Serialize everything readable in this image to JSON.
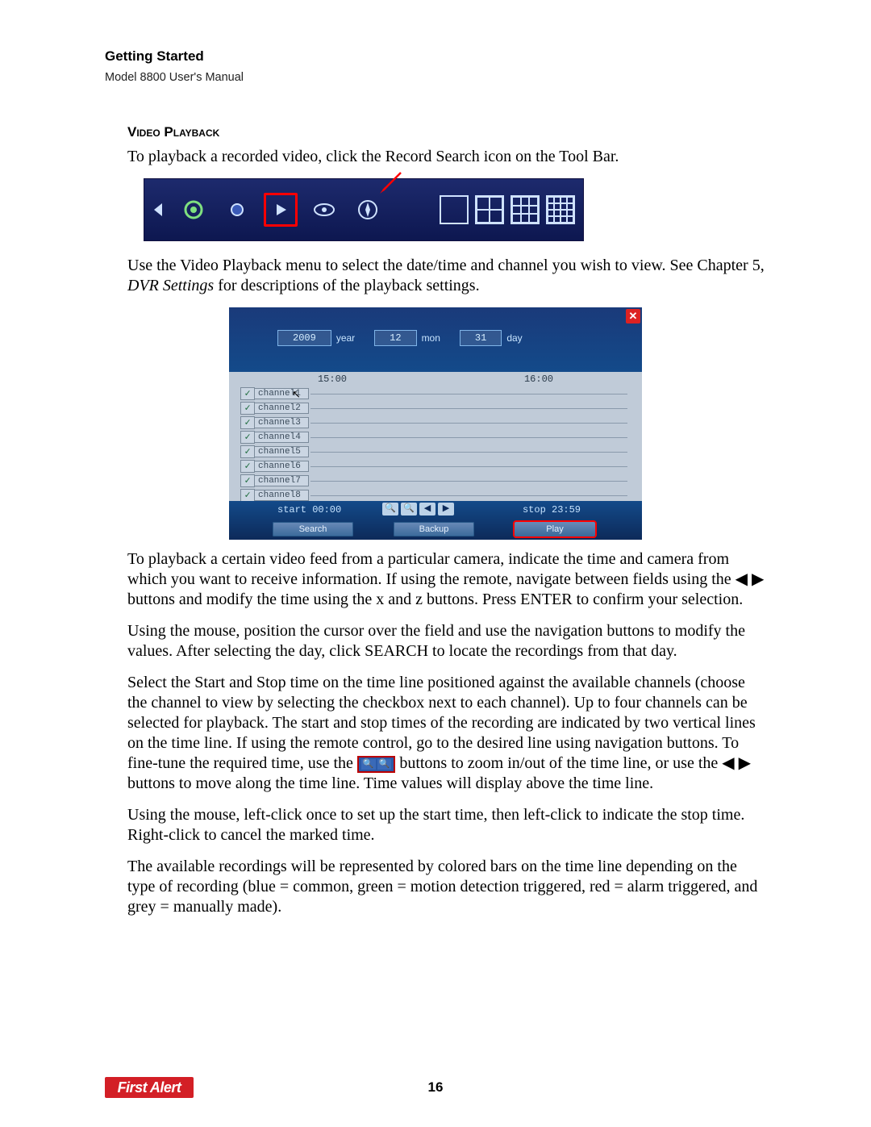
{
  "header": {
    "section": "Getting Started",
    "manual": "Model 8800 User's Manual"
  },
  "section_heading": "Video Playback",
  "intro_text": "To playback a recorded video, click the Record Search icon on the Tool Bar.",
  "toolbar_icons": {
    "left_triangle": "left-triangle-icon",
    "gear": "gear-icon",
    "record": "record-dot-icon",
    "play": "play-icon",
    "eye": "preview-eye-icon",
    "ptz": "ptz-compass-icon",
    "view1": "single-view-icon",
    "view4": "quad-view-icon",
    "view9": "nine-view-icon",
    "view16": "sixteen-view-icon"
  },
  "menu_text_1a": "Use the Video Playback menu to select the date/time and channel you wish to view. See Chapter 5, ",
  "menu_text_1b": "DVR Settings",
  "menu_text_1c": " for descriptions of the playback settings.",
  "playback_menu": {
    "year_value": "2009",
    "year_label": "year",
    "mon_value": "12",
    "mon_label": "mon",
    "day_value": "31",
    "day_label": "day",
    "time_left": "15:00",
    "time_right": "16:00",
    "channels": [
      "channel1",
      "channel2",
      "channel3",
      "channel4",
      "channel5",
      "channel6",
      "channel7",
      "channel8"
    ],
    "start_label": "start 00:00",
    "stop_label": "stop 23:59",
    "btn_search": "Search",
    "btn_backup": "Backup",
    "btn_play": "Play"
  },
  "para2": "To playback a certain video feed from a particular camera, indicate the time and camera from which you want to receive information. If using the remote, navigate between fields using the ◀ ▶ buttons and modify the time using the  x and  z buttons. Press ENTER to confirm your selection.",
  "para3": "Using the mouse, position the cursor over the field and use the navigation buttons to modify the values. After selecting the day, click SEARCH to locate the recordings from that day.",
  "para4a": "Select the Start and Stop time on the time line positioned against the available channels (choose the channel to view by selecting the checkbox next to each channel). Up to four channels can be selected for playback. The start and stop times of the recording are indicated by two vertical lines on the time line. If using the remote control, go to the desired line using navigation buttons. To fine-tune the required time, use the ",
  "para4b": " buttons to zoom in/out of the time line, or use the ◀ ▶ buttons to move along the time line. Time values will display above the time line.",
  "para5": "Using the mouse, left-click once to set up the start time, then left-click to indicate the stop time. Right-click to cancel the marked time.",
  "para6": "The available recordings will be represented by colored bars on the time line depending on the type of recording (blue = common, green = motion detection triggered, red = alarm triggered, and grey = manually made).",
  "footer": {
    "logo_text": "First Alert",
    "page_number": "16"
  }
}
